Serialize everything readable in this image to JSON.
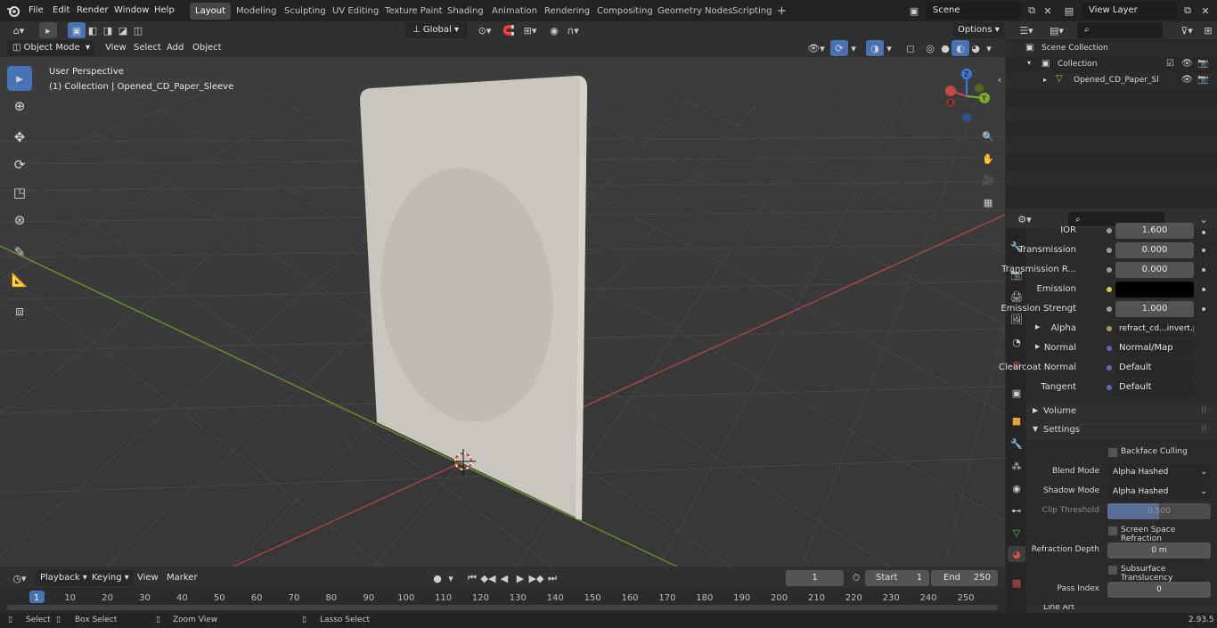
{
  "topbar": {
    "menus": [
      "File",
      "Edit",
      "Render",
      "Window",
      "Help"
    ],
    "workspaces": [
      "Layout",
      "Modeling",
      "Sculpting",
      "UV Editing",
      "Texture Paint",
      "Shading",
      "Animation",
      "Rendering",
      "Compositing",
      "Geometry Nodes",
      "Scripting"
    ],
    "active_workspace": "Layout",
    "add_tab": "+",
    "scene": "Scene",
    "view_layer": "View Layer"
  },
  "viewport_header": {
    "mode": "Object Mode",
    "menus": [
      "View",
      "Select",
      "Add",
      "Object"
    ],
    "orientation": "Global",
    "options": "Options"
  },
  "viewport": {
    "perspective": "User Perspective",
    "collection_info": "(1) Collection | Opened_CD_Paper_Sleeve",
    "gizmo": {
      "z": "Z",
      "y": "Y",
      "x": "X"
    }
  },
  "outliner": {
    "scene_collection": "Scene Collection",
    "collection": "Collection",
    "object": "Opened_CD_Paper_Sleev"
  },
  "properties": {
    "rows": [
      {
        "label": "IOR",
        "value": "1.600",
        "dot": "#9a9a9a"
      },
      {
        "label": "Transmission",
        "value": "0.000",
        "dot": "#9a9a9a"
      },
      {
        "label": "Transmission R...",
        "value": "0.000",
        "dot": "#9a9a9a"
      },
      {
        "label": "Emission",
        "value": "",
        "dot": "#d8c44a"
      },
      {
        "label": "Emission Strengt",
        "value": "1.000",
        "dot": "#9a9a9a"
      },
      {
        "label": "Alpha",
        "value": "refract_cd...invert.png",
        "dot": "#a79a5a"
      },
      {
        "label": "Normal",
        "value": "Normal/Map",
        "dot": "#6363c7"
      },
      {
        "label": "Clearcoat Normal",
        "value": "Default",
        "dot": "#6363c7"
      },
      {
        "label": "Tangent",
        "value": "Default",
        "dot": "#6363c7"
      }
    ],
    "volume": "Volume",
    "settings": "Settings",
    "backface_culling": "Backface Culling",
    "blend_mode_label": "Blend Mode",
    "blend_mode": "Alpha Hashed",
    "shadow_mode_label": "Shadow Mode",
    "shadow_mode": "Alpha Hashed",
    "clip_threshold_label": "Clip Threshold",
    "clip_threshold": "0.500",
    "screen_space_refraction": "Screen Space Refraction",
    "refraction_depth_label": "Refraction Depth",
    "refraction_depth": "0 m",
    "subsurface_translucency": "Subsurface Translucency",
    "pass_index_label": "Pass Index",
    "pass_index": "0",
    "line_art": "Line Art"
  },
  "timeline": {
    "menus": [
      "Playback",
      "Keying",
      "View",
      "Marker"
    ],
    "current_frame": "1",
    "start_label": "Start",
    "start": "1",
    "end_label": "End",
    "end": "250",
    "ticks": [
      "1",
      "10",
      "20",
      "30",
      "40",
      "50",
      "60",
      "70",
      "80",
      "90",
      "100",
      "110",
      "120",
      "130",
      "140",
      "150",
      "160",
      "170",
      "180",
      "190",
      "200",
      "210",
      "220",
      "230",
      "240",
      "250"
    ]
  },
  "statusbar": {
    "select": "Select",
    "box_select": "Box Select",
    "zoom_view": "Zoom View",
    "lasso_select": "Lasso Select",
    "version": "2.93.5"
  }
}
